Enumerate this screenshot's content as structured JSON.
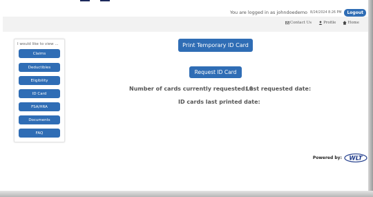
{
  "header": {
    "login_text": "You are logged in as johndoedemo",
    "login_date": "8/24/2024 8:26 PM",
    "logout_label": "Logout"
  },
  "nav": {
    "contact_label": "Contact Us",
    "profile_label": "Profile",
    "home_label": "Home"
  },
  "sidebar": {
    "title": "I would like to view ...",
    "items": [
      {
        "label": "Claims"
      },
      {
        "label": "Deductibles"
      },
      {
        "label": "Eligibility"
      },
      {
        "label": "ID Card"
      },
      {
        "label": "FSA/HRA"
      },
      {
        "label": "Documents"
      },
      {
        "label": "FAQ"
      }
    ]
  },
  "main": {
    "print_button_label": "Print Temporary ID Card",
    "request_button_label": "Request ID Card",
    "cards_requested_text": "Number of cards currently requested: 0",
    "last_requested_text": "Last requested date:",
    "last_printed_text": "ID cards last printed date:"
  },
  "footer": {
    "powered_by": "Powered by:",
    "logo_text": "WLT"
  },
  "colors": {
    "accent": "#2f6db5",
    "nav_band": "#f2f2f2",
    "top_marks": "#1e2a5c"
  },
  "icons": [
    "envelope-icon",
    "user-icon",
    "home-icon"
  ]
}
